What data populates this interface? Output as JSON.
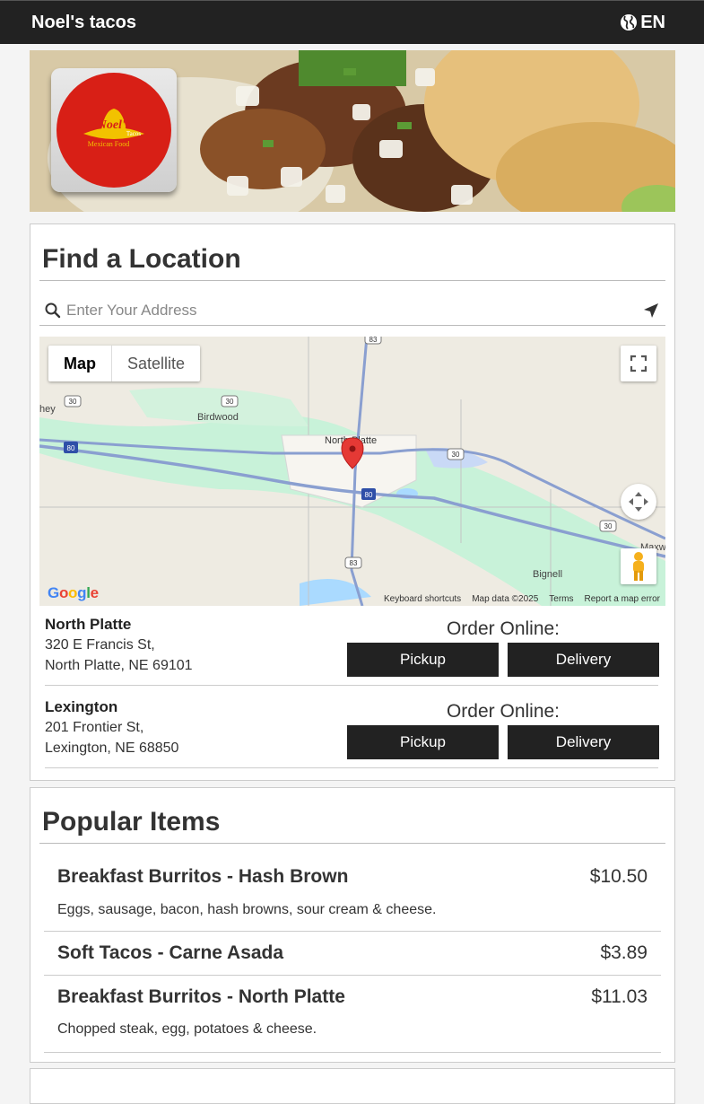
{
  "header": {
    "brand": "Noel's tacos",
    "language": "EN",
    "globe_icon": "globe-icon"
  },
  "hero": {
    "logo_text_top": "Noel's",
    "logo_text_bottom": "Mexican Food",
    "logo_small": "Tacos"
  },
  "find_location": {
    "title": "Find a Location",
    "search_placeholder": "Enter Your Address",
    "search_icon": "search-icon",
    "send_icon": "send-location-icon"
  },
  "map": {
    "tabs": [
      {
        "label": "Map",
        "active": true
      },
      {
        "label": "Satellite",
        "active": false
      }
    ],
    "places": [
      "Birdwood",
      "North Platte",
      "Bignell",
      "Maxw",
      "hey"
    ],
    "shields": [
      "83",
      "30",
      "30",
      "80",
      "30",
      "80",
      "30",
      "83",
      "80"
    ],
    "google": "Google",
    "footer": [
      "Keyboard shortcuts",
      "Map data ©2025",
      "Terms",
      "Report a map error"
    ]
  },
  "locations": [
    {
      "name": "North Platte",
      "address1": "320 E Francis St,",
      "address2": "North Platte, NE 69101",
      "order_label": "Order Online:",
      "pickup": "Pickup",
      "delivery": "Delivery"
    },
    {
      "name": "Lexington",
      "address1": "201 Frontier St,",
      "address2": "Lexington, NE 68850",
      "order_label": "Order Online:",
      "pickup": "Pickup",
      "delivery": "Delivery"
    }
  ],
  "popular": {
    "title": "Popular Items",
    "items": [
      {
        "name": "Breakfast Burritos - Hash Brown",
        "price": "$10.50",
        "desc": "Eggs, sausage, bacon, hash browns, sour cream & cheese."
      },
      {
        "name": "Soft Tacos - Carne Asada",
        "price": "$3.89",
        "desc": ""
      },
      {
        "name": "Breakfast Burritos - North Platte",
        "price": "$11.03",
        "desc": "Chopped steak, egg, potatoes & cheese."
      }
    ]
  },
  "colors": {
    "topbar": "#222222",
    "button": "#222222",
    "map_marker": "#e53935",
    "water": "#aadaff",
    "park": "#c8f2d9"
  }
}
